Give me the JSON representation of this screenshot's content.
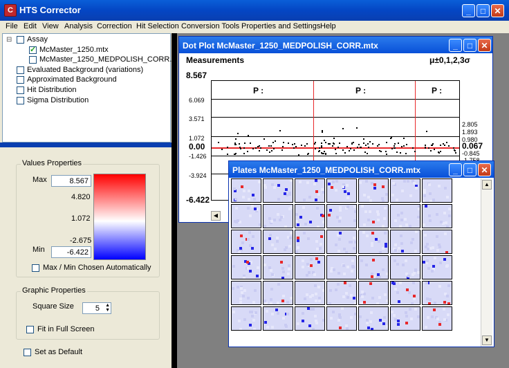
{
  "app": {
    "title": "HTS Corrector",
    "icon": "C"
  },
  "window_controls": {
    "minimize": "_",
    "maximize": "□",
    "close": "✕"
  },
  "menu": [
    "File",
    "Edit",
    "View",
    "Analysis",
    "Correction",
    "Hit Selection",
    "Conversion Tools",
    "Properties and Settings",
    "Help"
  ],
  "tree": {
    "root": "Assay",
    "items": [
      {
        "label": "McMaster_1250.mtx",
        "checked": true
      },
      {
        "label": "McMaster_1250_MEDPOLISH_CORR.mtx",
        "checked": false
      }
    ],
    "others": [
      "Evaluated Background (variations)",
      "Approximated Background",
      "Hit Distribution",
      "Sigma Distribution"
    ]
  },
  "values_properties": {
    "title": "Values Properties",
    "max_label": "Max",
    "max_value": "8.567",
    "scale_labels": [
      "4.820",
      "1.072",
      "-2.675"
    ],
    "min_label": "Min",
    "min_value": "-6.422",
    "auto_label": "Max / Min Chosen Automatically"
  },
  "graphic_properties": {
    "title": "Graphic Properties",
    "square_size_label": "Square Size",
    "square_size": "5",
    "fit_label": "Fit in Full Screen"
  },
  "set_default_label": "Set as Default",
  "dot_plot": {
    "title": "Dot Plot McMaster_1250_MEDPOLISH_CORR.mtx",
    "header": "Measurements",
    "sigma_label": "μ±0,1,2,3σ",
    "y_top": "8.567",
    "y_bottom": "-6.422",
    "left_ticks": [
      "6.069",
      "3.571",
      "1.072",
      "0.00",
      "-1.426",
      "-3.924"
    ],
    "right_ticks": [
      "2.805",
      "1.893",
      "0.980",
      "0.067",
      "-0.845",
      "-1.758"
    ],
    "plate_labels": [
      "P :",
      "P :",
      "P :"
    ]
  },
  "plates_window": {
    "title": "Plates McMaster_1250_MEDPOLISH_CORR.mtx",
    "rows": 6,
    "cols": 7
  },
  "colors": {
    "hot": "#e8282a",
    "cold": "#2626e8",
    "neutral": "#ffffff",
    "title_blue": "#0850d8"
  }
}
